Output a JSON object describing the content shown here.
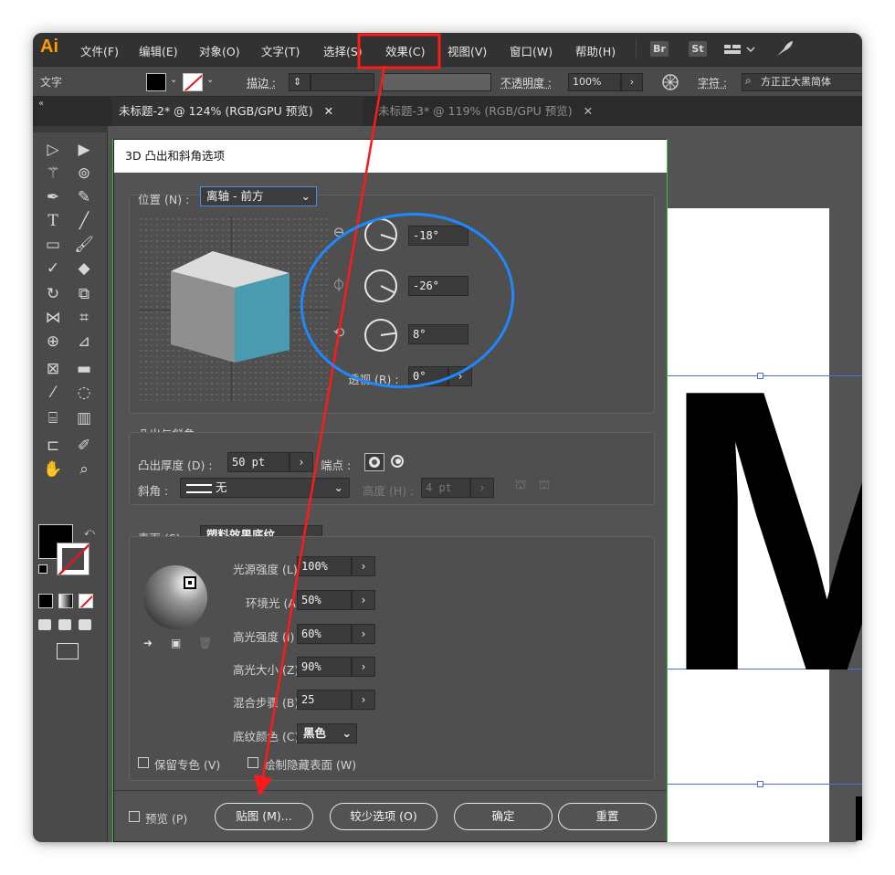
{
  "app": {
    "logo": "Ai",
    "menu": [
      "文件(F)",
      "编辑(E)",
      "对象(O)",
      "文字(T)",
      "选择(S)",
      "效果(C)",
      "视图(V)",
      "窗口(W)",
      "帮助(H)"
    ],
    "bridge_label": "Br",
    "stock_label": "St",
    "layout_icon": "workspace-grid-icon"
  },
  "controlbar": {
    "context_label": "文字",
    "stroke_label": "描边 :",
    "opacity_label": "不透明度 :",
    "opacity_value": "100%",
    "char_label": "字符 :",
    "font_value": "方正正大黑简体"
  },
  "tabs": [
    {
      "label": "未标题-2* @ 124% (RGB/GPU 预览)",
      "active": true
    },
    {
      "label": "未标题-3* @ 119% (RGB/GPU 预览)",
      "active": false
    }
  ],
  "dialog": {
    "title": "3D 凸出和斜角选项",
    "position_label": "位置 (N) :",
    "position_value": "离轴 - 前方",
    "rotation_x": "-18°",
    "rotation_y": "-26°",
    "rotation_z": "8°",
    "perspective_label": "透视 (R) :",
    "perspective_value": "0°",
    "extrude_section": "凸出与斜角",
    "extrude_depth_label": "凸出厚度 (D) :",
    "extrude_depth_value": "50 pt",
    "cap_label": "端点 :",
    "bevel_label": "斜角 :",
    "bevel_value": "无",
    "height_label": "高度 (H) :",
    "height_value": "4 pt",
    "surface_label": "表面 (S) :",
    "surface_value": "塑料效果底纹",
    "light_intensity_label": "光源强度 (L) :",
    "light_intensity_value": "100%",
    "ambient_label": "环境光 (A) :",
    "ambient_value": "50%",
    "highlight_intensity_label": "高光强度 (I) :",
    "highlight_intensity_value": "60%",
    "highlight_size_label": "高光大小 (Z) :",
    "highlight_size_value": "90%",
    "blend_steps_label": "混合步骤 (B) :",
    "blend_steps_value": "25",
    "shade_color_label": "底纹颜色 (C) :",
    "shade_color_value": "黑色",
    "preserve_spot": "保留专色 (V)",
    "draw_hidden": "绘制隐藏表面 (W)",
    "preview": "预览 (P)",
    "map_btn": "贴图 (M)...",
    "fewer_btn": "较少选项 (O)",
    "ok_btn": "确定",
    "reset_btn": "重置"
  },
  "canvas": {
    "glyph": "M"
  },
  "colors": {
    "cube_front": "#4a9ab0",
    "annotation_red": "#ff1a1a",
    "annotation_blue": "#1e88ff",
    "guide_blue": "#4a6fd8",
    "ai_orange": "#ff9a00"
  }
}
